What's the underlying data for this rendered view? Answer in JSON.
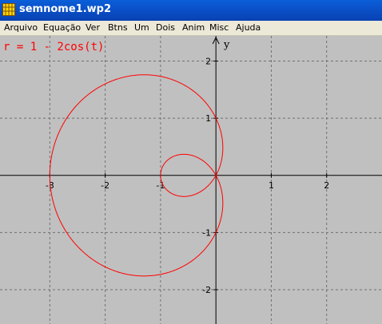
{
  "window": {
    "title": "semnome1.wp2",
    "icon": "app-grid-icon"
  },
  "menu": {
    "items": [
      "Arquivo",
      "Equação",
      "Ver",
      "Btns",
      "Um",
      "Dois",
      "Anim",
      "Misc",
      "Ajuda"
    ]
  },
  "plot": {
    "equation_label": "r = 1 - 2cos(t)",
    "axis_y_label": "y",
    "x_ticks": [
      "-3",
      "-2",
      "-1",
      "1",
      "2"
    ],
    "y_ticks": [
      "2",
      "1",
      "-1",
      "-2"
    ],
    "background_color": "#c0c0c0",
    "curve_color": "#ff0000",
    "axis_color": "#000000",
    "grid_color": "#707070"
  },
  "chart_data": {
    "type": "line",
    "function": "r = 1 - 2cos(t)",
    "coordinates": "polar",
    "xlim": [
      -3.9,
      3.0
    ],
    "ylim": [
      -2.6,
      2.44
    ],
    "x_grid": [
      -3,
      -2,
      -1,
      0,
      1,
      2
    ],
    "y_grid": [
      -2,
      -1,
      0,
      1,
      2
    ],
    "grid": true,
    "grid_style": "dashed",
    "series": [
      {
        "r_coefficients": {
          "a": 1,
          "b": -2
        },
        "t_range": [
          0,
          6.2832
        ],
        "color": "#ff0000"
      }
    ]
  }
}
